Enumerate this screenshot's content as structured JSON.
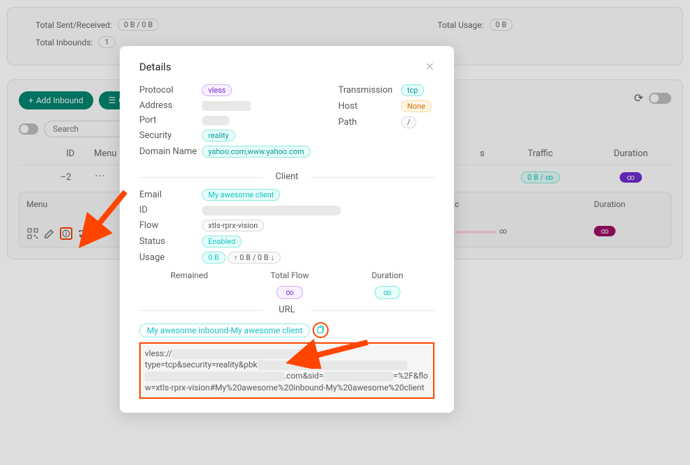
{
  "stats": {
    "sent_label": "Total Sent/Received:",
    "sent_value": "0 B / 0 B",
    "usage_label": "Total Usage:",
    "usage_value": "0 B",
    "inbounds_label": "Total Inbounds:",
    "inbounds_value": "1"
  },
  "toolbar": {
    "add": "Add Inbound",
    "general": "G",
    "search_placeholder": "Search"
  },
  "table": {
    "headers": {
      "id": "ID",
      "menu": "Menu",
      "s": "s",
      "traffic": "Traffic",
      "duration": "Duration"
    },
    "row": {
      "id": "2",
      "traffic": "0 B / ∞",
      "duration": "∞"
    },
    "sub": {
      "menu": "Menu",
      "c": "c",
      "duration": "Duration",
      "inf": "∞"
    }
  },
  "modal": {
    "title": "Details",
    "left": {
      "protocol_l": "Protocol",
      "protocol_v": "vless",
      "address_l": "Address",
      "port_l": "Port",
      "security_l": "Security",
      "security_v": "reality",
      "domain_l": "Domain Name",
      "domain_v": "yahoo.com,www.yahoo.com"
    },
    "right": {
      "trans_l": "Transmission",
      "trans_v": "tcp",
      "host_l": "Host",
      "host_v": "None",
      "path_l": "Path",
      "path_v": "/"
    },
    "client_section": "Client",
    "client": {
      "email_l": "Email",
      "email_v": "My awesome client",
      "id_l": "ID",
      "flow_l": "Flow",
      "flow_v": "xtls-rprx-vision",
      "status_l": "Status",
      "status_v": "Enabled",
      "usage_l": "Usage",
      "usage_v1": "0 B",
      "usage_v2": "↑ 0 B / 0 B ↓"
    },
    "stats": {
      "remained_l": "Remained",
      "flow_l": "Total Flow",
      "flow_v": "∞",
      "duration_l": "Duration",
      "duration_v": "∞"
    },
    "url_section": "URL",
    "url_tag": "My awesome inbound-My awesome client",
    "url_line1": "vless://",
    "url_line2": "type=tcp&security=reality&pbk",
    "url_line3": ".com&sid=",
    "url_line4": "=%2F&flo",
    "url_line5": "w=xtls-rprx-vision#My%20awesome%20inbound-My%20awesome%20client"
  }
}
